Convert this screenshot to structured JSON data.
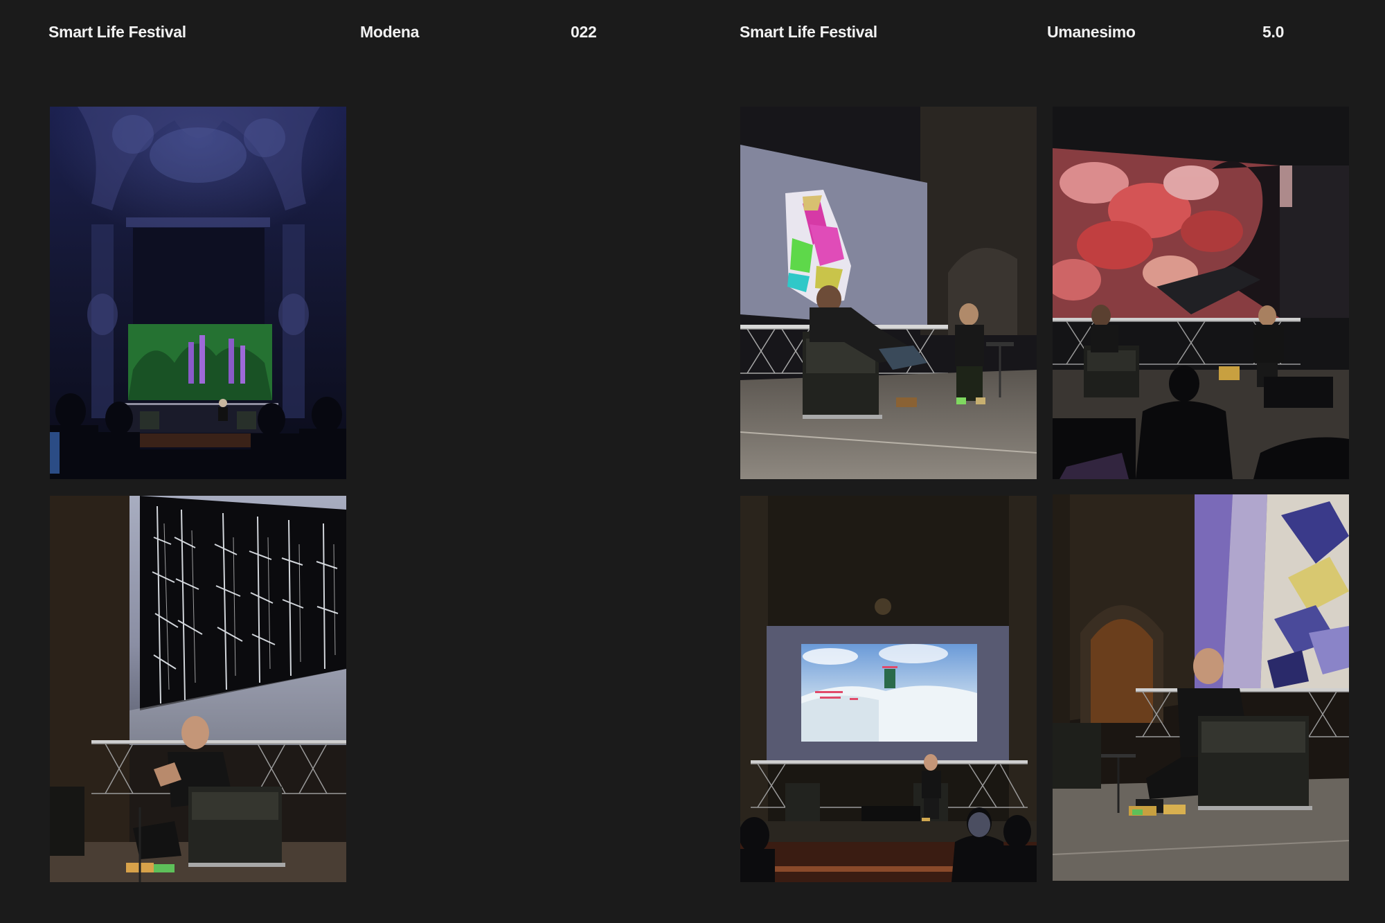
{
  "left_page": {
    "festival": "Smart Life Festival",
    "city": "Modena",
    "page_number": "022"
  },
  "right_page": {
    "festival": "Smart Life Festival",
    "theme": "Umanesimo",
    "version": "5.0"
  },
  "colors": {
    "background": "#1b1b1b",
    "text": "#f2f2f2"
  }
}
